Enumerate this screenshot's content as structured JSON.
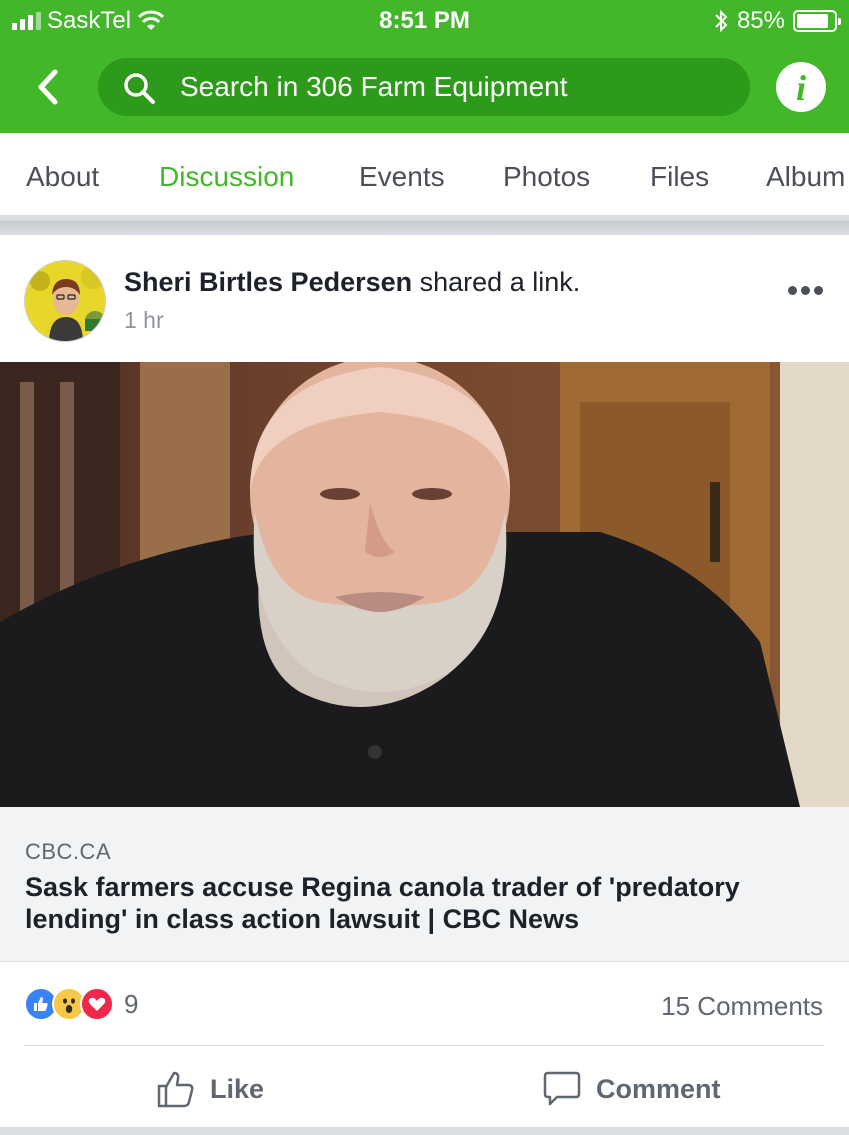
{
  "status_bar": {
    "carrier": "SaskTel",
    "time": "8:51 PM",
    "battery": "85%",
    "battery_level": 0.85
  },
  "header": {
    "search_placeholder": "Search in 306 Farm Equipment",
    "info_glyph": "i"
  },
  "tabs": [
    {
      "label": "About"
    },
    {
      "label": "Discussion",
      "active": true
    },
    {
      "label": "Events"
    },
    {
      "label": "Photos"
    },
    {
      "label": "Files"
    },
    {
      "label": "Album"
    }
  ],
  "post": {
    "author": "Sheri Birtles Pedersen",
    "action": " shared a link.",
    "time": "1 hr",
    "link": {
      "source": "CBC.CA",
      "title": "Sask farmers accuse Regina canola trader of 'predatory lending' in class action lawsuit | CBC News"
    },
    "reaction_count": "9",
    "comments": "15 Comments",
    "like_label": "Like",
    "comment_label": "Comment"
  },
  "colors": {
    "brand_green": "#42b72a",
    "search_bg": "#2e9a1c",
    "like_blue": "#3b82f6",
    "wow_yellow": "#f7c948",
    "love_red": "#f0284a"
  }
}
